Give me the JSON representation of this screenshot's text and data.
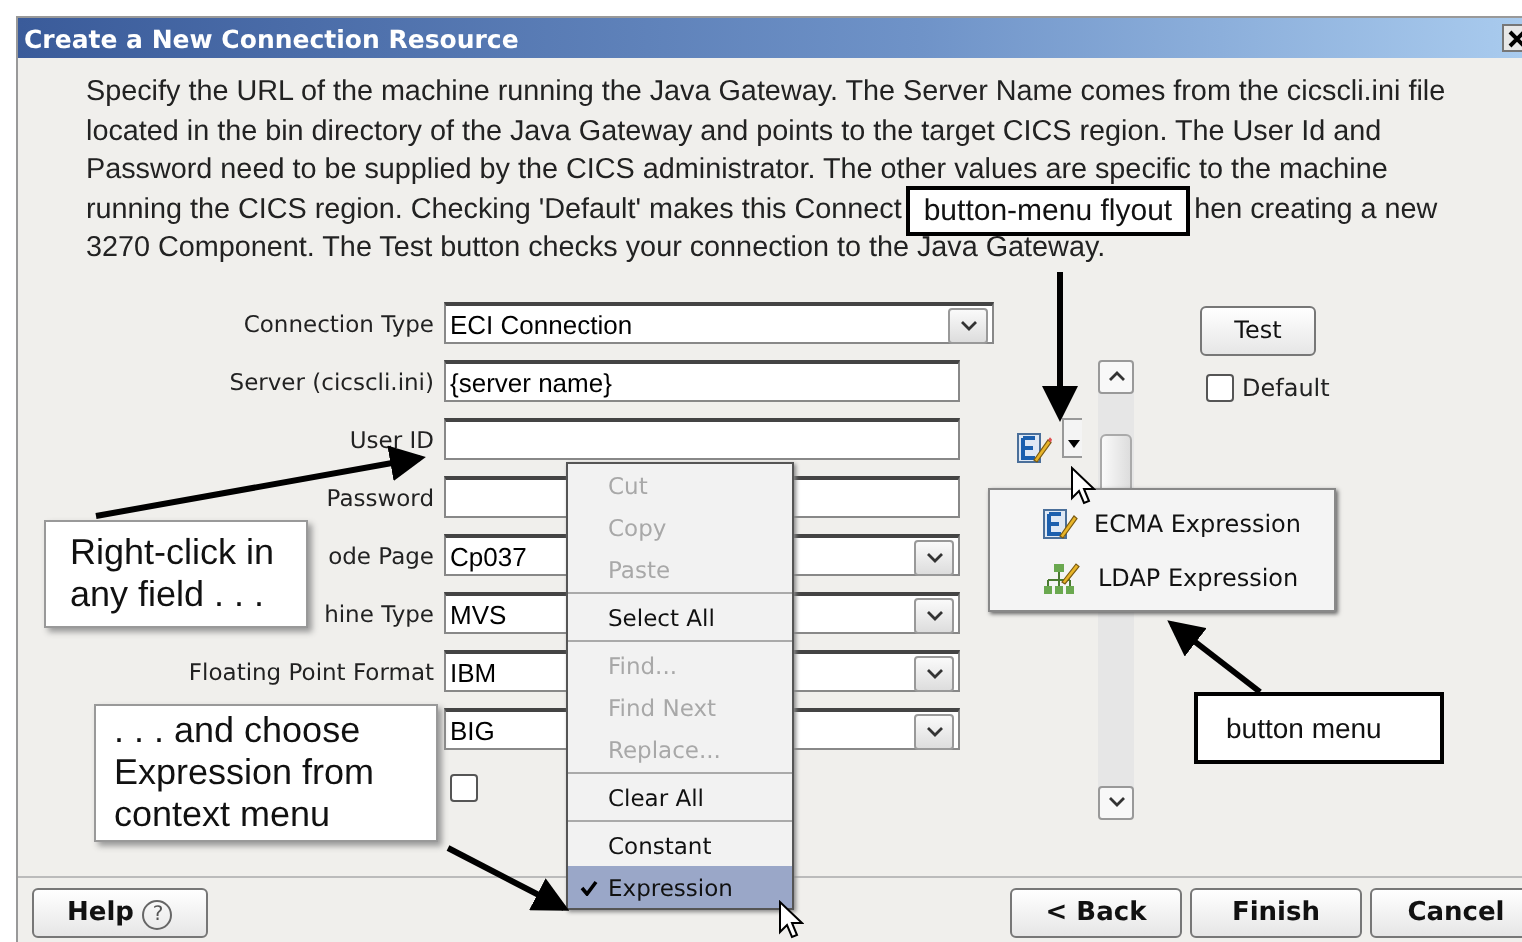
{
  "window": {
    "title": "Create a New Connection Resource"
  },
  "description": [
    [
      "Specify the URL of the machine running the Java Gateway. The Server Name comes from the cicscli.ini file"
    ],
    [
      "located in the bin directory of the Java Gateway and points to the target CICS region. The User Id and"
    ],
    [
      "Password need to be supplied by the CICS administrator. The other values are specific to the machine"
    ],
    [
      "running the CICS region. Checking 'Default' makes this Connect",
      "hen creating a new"
    ],
    [
      "3270 Component. The Test button checks your connection to the Java Gateway."
    ]
  ],
  "form": [
    {
      "label": "Connection Type",
      "kind": "select",
      "value": "ECI Connection"
    },
    {
      "label": "Server (cicscli.ini)",
      "kind": "text",
      "value": "{server name}"
    },
    {
      "label": "User ID",
      "kind": "text"
    },
    {
      "label": "Password",
      "kind": "text"
    },
    {
      "label": "ode Page",
      "kind": "select",
      "value": "Cp037"
    },
    {
      "label": "hine Type",
      "kind": "select",
      "value": "MVS"
    },
    {
      "label": "Floating Point Format",
      "kind": "select",
      "value": "IBM"
    },
    {
      "kind": "select",
      "value": "BIG"
    },
    {
      "kind": "checkbox",
      "checked": false
    }
  ],
  "test_button": "Test",
  "default_checkbox": {
    "label": "Default",
    "checked": false
  },
  "flyout_menu": [
    {
      "label": "ECMA Expression",
      "kind": "ecma"
    },
    {
      "label": "LDAP Expression",
      "kind": "ldap"
    }
  ],
  "context_menu": [
    {
      "kind": "item",
      "label": "Cut",
      "disabled": true,
      "checked": false,
      "selected": false
    },
    {
      "kind": "item",
      "label": "Copy",
      "disabled": true,
      "checked": false,
      "selected": false
    },
    {
      "kind": "item",
      "label": "Paste",
      "disabled": true,
      "checked": false,
      "selected": false
    },
    {
      "kind": "separator"
    },
    {
      "kind": "item",
      "label": "Select All",
      "disabled": false,
      "checked": false,
      "selected": false
    },
    {
      "kind": "separator"
    },
    {
      "kind": "item",
      "label": "Find...",
      "disabled": true,
      "checked": false,
      "selected": false
    },
    {
      "kind": "item",
      "label": "Find Next",
      "disabled": true,
      "checked": false,
      "selected": false
    },
    {
      "kind": "item",
      "label": "Replace...",
      "disabled": true,
      "checked": false,
      "selected": false
    },
    {
      "kind": "separator"
    },
    {
      "kind": "item",
      "label": "Clear All",
      "disabled": false,
      "checked": false,
      "selected": false
    },
    {
      "kind": "separator"
    },
    {
      "kind": "item",
      "label": "Constant",
      "disabled": false,
      "checked": false,
      "selected": false
    },
    {
      "kind": "item",
      "label": "Expression",
      "disabled": false,
      "checked": true,
      "selected": true
    }
  ],
  "annotations": [
    "button-menu flyout",
    "Right-click in any field . . .",
    ". . . and choose Expression from context menu",
    "button menu"
  ],
  "footer": {
    "help": "Help",
    "help_icon": "?",
    "buttons": [
      "< Back",
      "Finish",
      "Cancel"
    ]
  }
}
